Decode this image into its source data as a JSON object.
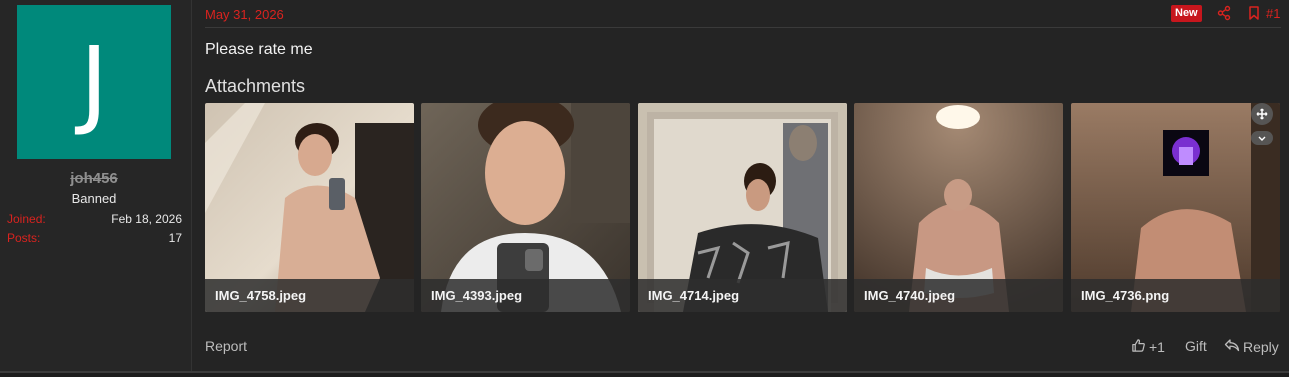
{
  "user": {
    "avatar_letter": "J",
    "avatar_color": "#00897b",
    "username": "joh456",
    "title": "Banned",
    "stats": [
      {
        "label": "Joined:",
        "value": "Feb 18, 2026"
      },
      {
        "label": "Posts:",
        "value": "17"
      }
    ]
  },
  "post": {
    "date": "May 31, 2026",
    "badge": "New",
    "number": "#1",
    "message": "Please rate me",
    "attachments_title": "Attachments",
    "attachments": [
      {
        "name": "IMG_4758.jpeg"
      },
      {
        "name": "IMG_4393.jpeg"
      },
      {
        "name": "IMG_4714.jpeg"
      },
      {
        "name": "IMG_4740.jpeg"
      },
      {
        "name": "IMG_4736.png"
      }
    ],
    "actions": {
      "report": "Report",
      "like": "+1",
      "gift": "Gift",
      "reply": "Reply"
    }
  },
  "colors": {
    "accent_red": "#d9231f",
    "badge_red": "#c7161d",
    "background": "#242424"
  },
  "icons": [
    "share-icon",
    "bookmark-icon",
    "thumbs-up-icon",
    "reply-icon",
    "expand-icon",
    "chevron-down-icon"
  ]
}
